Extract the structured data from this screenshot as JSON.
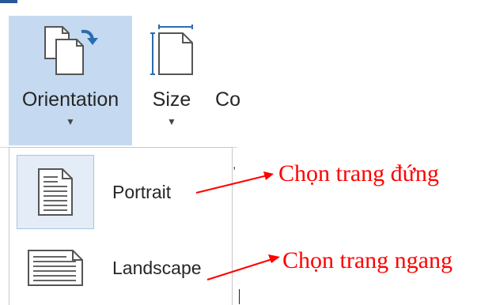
{
  "ribbon": {
    "buttons": [
      {
        "label": "Orientation",
        "icon": "orientation-icon",
        "active": true
      },
      {
        "label": "Size",
        "icon": "page-size-icon",
        "active": false
      },
      {
        "label": "Co",
        "icon": "",
        "active": false
      }
    ]
  },
  "menu": {
    "items": [
      {
        "label": "Portrait",
        "icon": "portrait-page-icon",
        "selected": true
      },
      {
        "label": "Landscape",
        "icon": "landscape-page-icon",
        "selected": false
      }
    ]
  },
  "annotations": [
    {
      "text": "Chọn trang đứng"
    },
    {
      "text": "Chọn trang ngang"
    }
  ],
  "colors": {
    "annotation": "#ff0000",
    "active": "#c5daf0",
    "accent": "#2b579a"
  }
}
